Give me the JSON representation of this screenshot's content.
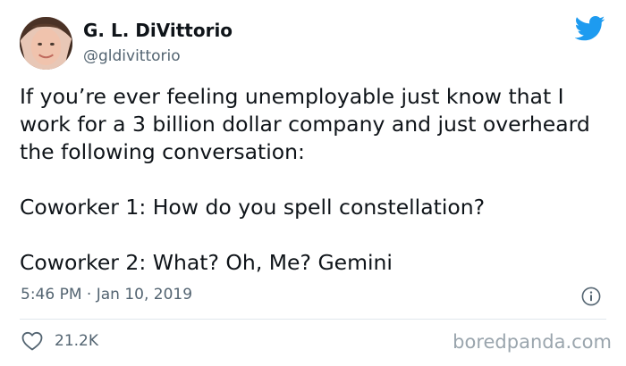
{
  "author": {
    "display_name": "G. L. DiVittorio",
    "handle": "@gldivittorio"
  },
  "tweet": {
    "paragraph_1": "If you’re ever feeling unemployable just know that I work for a 3 billion dollar company and just overheard the following conversation:",
    "paragraph_2": "Coworker 1: How do you spell constellation?",
    "paragraph_3": "Coworker 2: What? Oh, Me? Gemini",
    "timestamp": "5:46 PM · Jan 10, 2019",
    "like_count": "21.2K"
  },
  "watermark": "boredpanda.com",
  "icons": {
    "brand": "twitter-bird-icon",
    "info": "info-icon",
    "like": "heart-icon"
  },
  "colors": {
    "twitter_blue": "#1d9bf0",
    "text_primary": "#0f1419",
    "text_secondary": "#536471",
    "divider": "#e1e8ed",
    "watermark": "#9aa5ad"
  }
}
